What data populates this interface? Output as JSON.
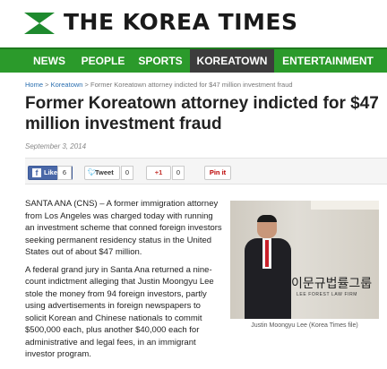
{
  "header": {
    "title": "THE KOREA TIMES"
  },
  "nav": {
    "items": [
      "NEWS",
      "PEOPLE",
      "SPORTS",
      "KOREATOWN",
      "ENTERTAINMENT"
    ],
    "active": "KOREATOWN"
  },
  "breadcrumb": {
    "home": "Home",
    "sep1": ">",
    "section": "Koreatown",
    "sep2": ">",
    "current": "Former Koreatown attorney indicted for $47 million investment fraud"
  },
  "article": {
    "headline": "Former Koreatown attorney indicted for $47 million investment fraud",
    "date": "September 3, 2014",
    "paragraphs": [
      "SANTA ANA (CNS) – A former immigration attorney from Los Angeles was charged today with running an investment scheme that conned foreign investors seeking permanent residency status in the United States out of about $47 million.",
      "A federal grand jury in Santa Ana returned a nine-count indictment alleging that Justin Moongyu Lee stole the money from 94 foreign investors, partly using advertisements in foreign newspapers to solicit Korean and Chinese nationals to commit $500,000 each, plus another $40,000 each for administrative and legal fees, in an immigrant investor program."
    ]
  },
  "share": {
    "facebook_label": "Like",
    "facebook_count": "6",
    "tweet_label": "Tweet",
    "tweet_count": "0",
    "gplus_label": "+1",
    "gplus_count": "0",
    "pinterest_label": "Pin it"
  },
  "photo": {
    "sign_korean": "이문규법률그룹",
    "sign_english": "LEE FOREST LAW FIRM",
    "caption": "Justin Moongyu Lee (Korea Times file)"
  },
  "colors": {
    "brand_green": "#2b9a2b",
    "active_tab": "#3c3c3c",
    "link_blue": "#2a6fb0"
  }
}
